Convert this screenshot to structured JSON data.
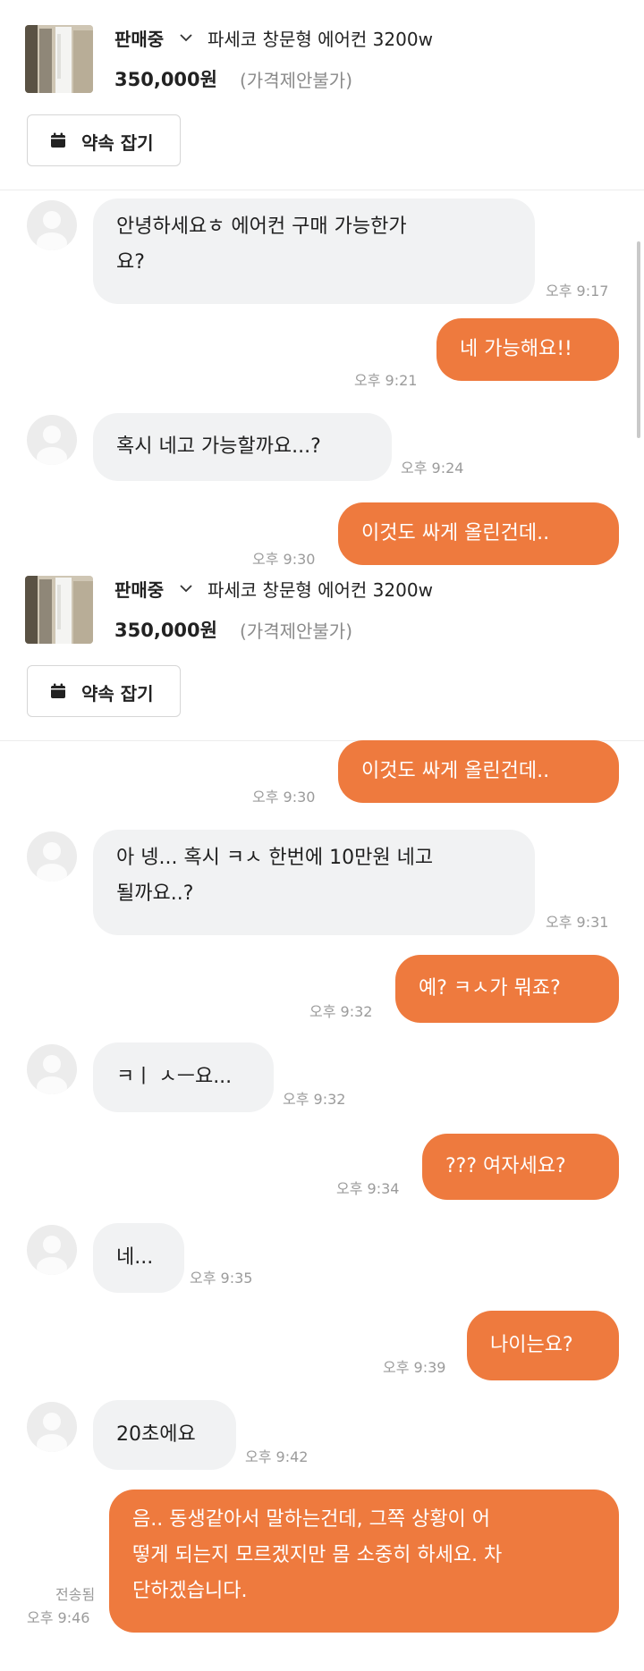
{
  "listing": {
    "status": "판매중",
    "title": "파세코 창문형 에어컨 3200w",
    "price": "350,000원",
    "price_note": "(가격제안불가)",
    "appointment_label": "약속 잡기"
  },
  "chat1": [
    {
      "text": "안녕하세요ㅎ 에어컨 구매 가능한가\n요?",
      "time": "오후 9:17"
    },
    {
      "text": "네 가능해요!!",
      "time": "오후 9:21"
    },
    {
      "text": "혹시 네고 가능할까요...?",
      "time": "오후 9:24"
    },
    {
      "text": "이것도 싸게 올린건데..",
      "time": "오후 9:30"
    }
  ],
  "chat2": [
    {
      "text": "이것도 싸게 올린건데..",
      "time": "오후 9:30"
    },
    {
      "text": "아 넹... 혹시 ㅋㅅ 한번에 10만원 네고\n될까요..?",
      "time": "오후 9:31"
    },
    {
      "text": "예? ㅋㅅ가 뭐죠?",
      "time": "오후 9:32"
    },
    {
      "text": "ㅋㅣ ㅅㅡ요...",
      "time": "오후 9:32"
    },
    {
      "text": "??? 여자세요?",
      "time": "오후 9:34"
    },
    {
      "text": "네...",
      "time": "오후 9:35"
    },
    {
      "text": "나이는요?",
      "time": "오후 9:39"
    },
    {
      "text": "20초에요",
      "time": "오후 9:42"
    },
    {
      "text": "음.. 동생같아서 말하는건데, 그쪽 상황이 어\n떻게 되는지 모르겠지만 몸 소중히 하세요. 차\n단하겠습니다.",
      "time": "오후 9:46",
      "status": "전송됨"
    }
  ],
  "colors": {
    "accent": "#ee7a3e",
    "incoming_bubble": "#f1f2f3"
  },
  "icons": [
    "chevron-down-icon",
    "calendar-icon",
    "user-avatar-icon"
  ]
}
